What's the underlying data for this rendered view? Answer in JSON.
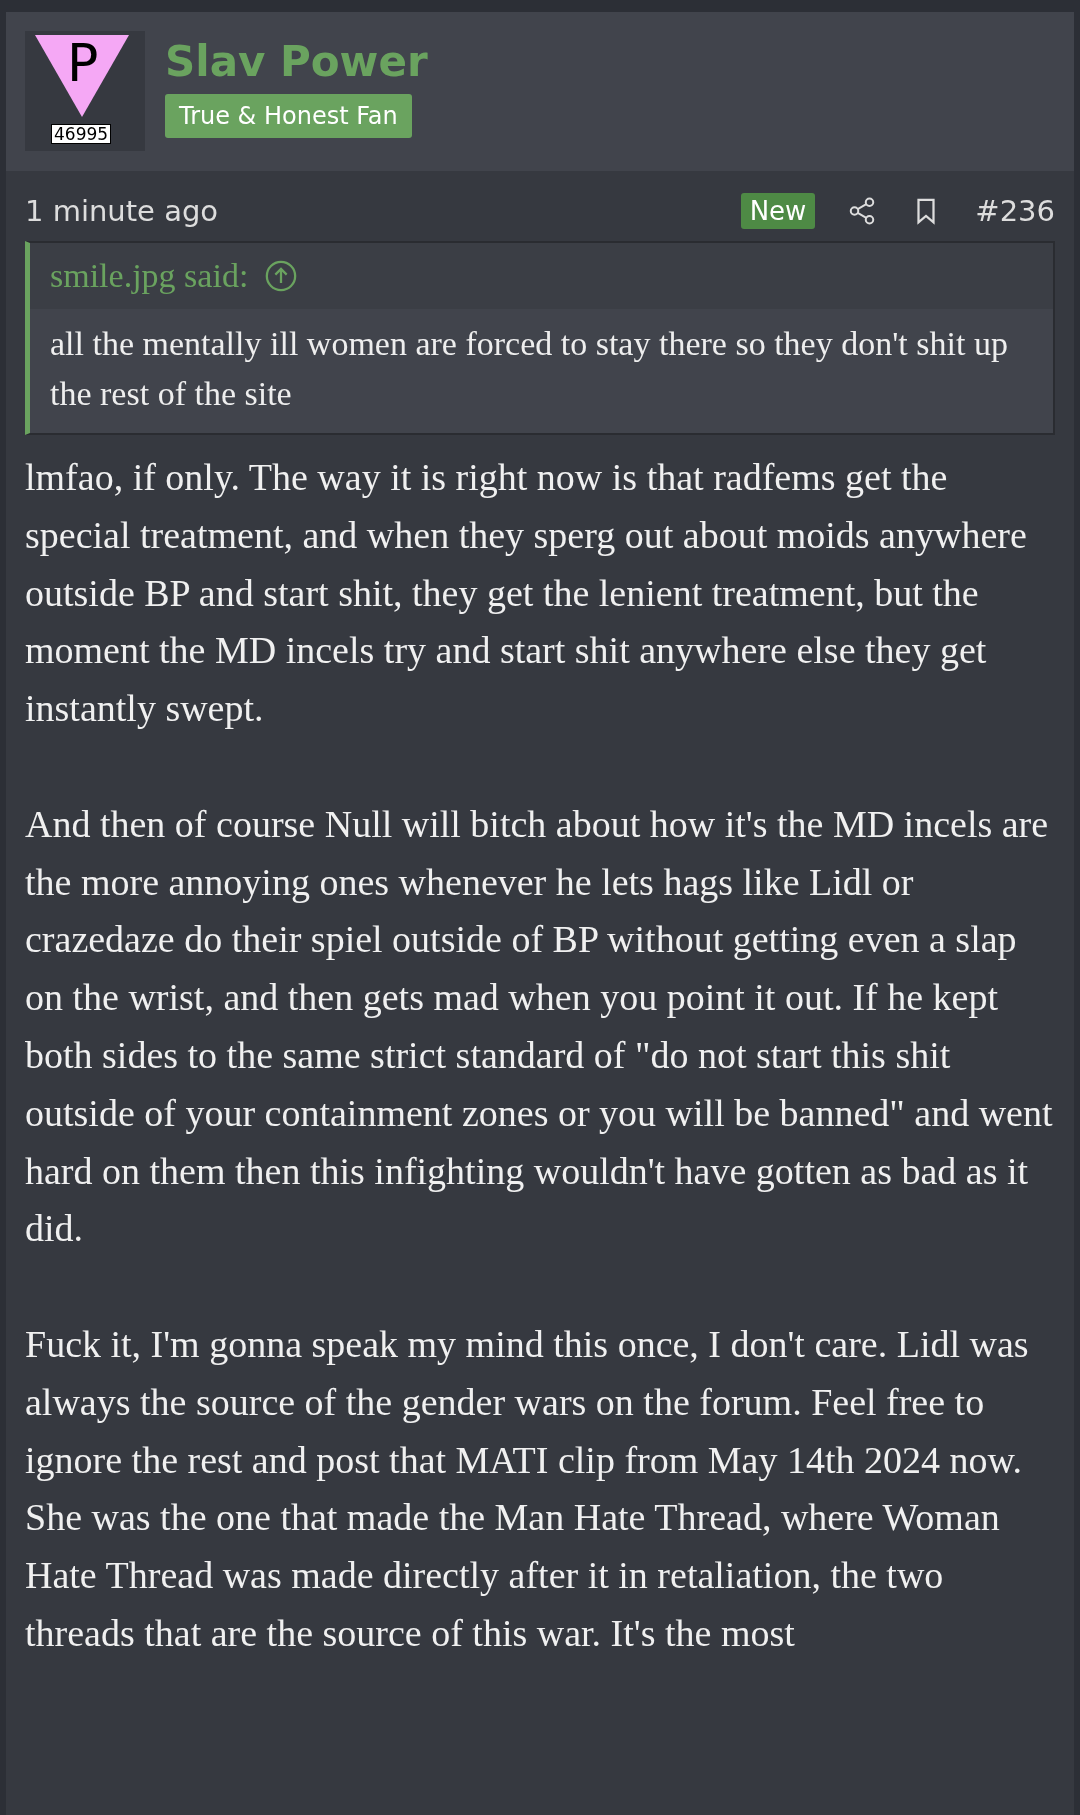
{
  "author": {
    "avatar": {
      "letter": "P",
      "number": "46995"
    },
    "name": "Slav Power",
    "title": "True & Honest Fan"
  },
  "meta": {
    "time": "1 minute ago",
    "new_badge": "New",
    "post_number": "#236"
  },
  "quote": {
    "attribution": "smile.jpg said:",
    "text": "all the mentally ill women are forced to stay there so they don't shit up the rest of the site"
  },
  "paragraphs": [
    "lmfao, if only. The way it is right now is that radfems get the special treatment, and when they sperg out about moids anywhere outside BP and start shit, they get the lenient treatment, but the moment the MD incels try and start shit anywhere else they get instantly swept.",
    "And then of course Null will bitch about how it's the MD incels are the more annoying ones whenever he lets hags like Lidl or crazedaze do their spiel outside of BP without getting even a slap on the wrist, and then gets mad when you point it out. If he kept both sides to the same strict standard of \"do not start this shit outside of your containment zones or you will be banned\" and went hard on them then this infighting wouldn't have gotten as bad as it did.",
    "Fuck it, I'm gonna speak my mind this once, I don't care. Lidl was always the source of the gender wars on the forum. Feel free to ignore the rest and post that MATI clip from May 14th 2024 now. She was the one that made the Man Hate Thread, where Woman Hate Thread was made directly after it in retaliation, the two threads that are the source of this war. It's the most"
  ]
}
